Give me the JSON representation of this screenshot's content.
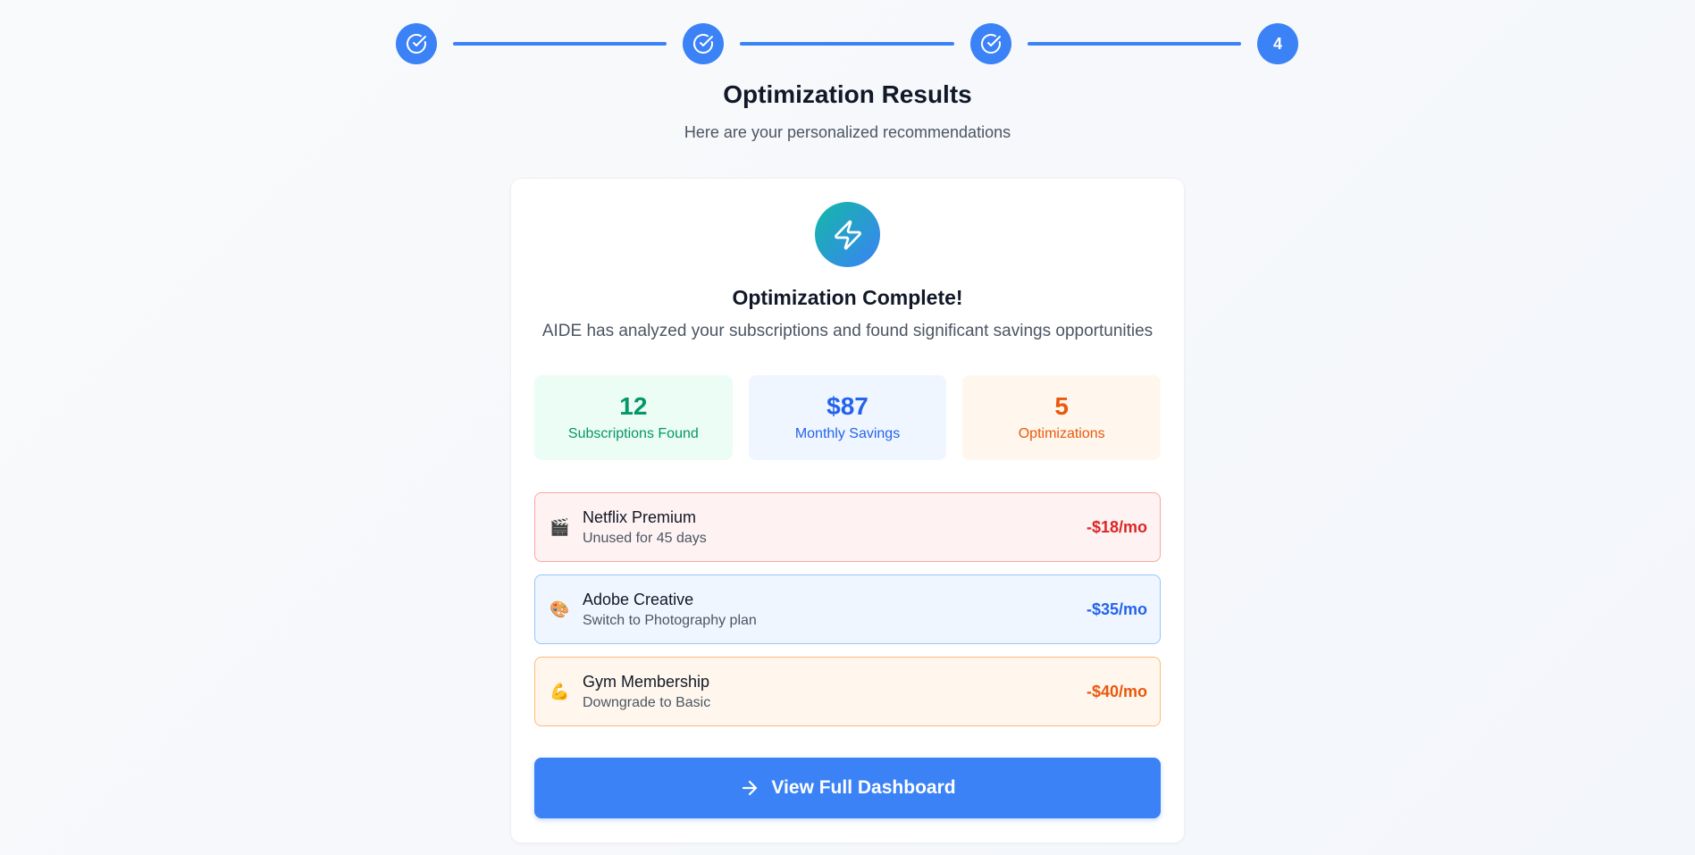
{
  "stepper": {
    "steps": [
      {
        "state": "complete",
        "icon": "check-circle-icon"
      },
      {
        "state": "complete",
        "icon": "check-circle-icon"
      },
      {
        "state": "complete",
        "icon": "check-circle-icon"
      },
      {
        "state": "current",
        "label": "4"
      }
    ]
  },
  "header": {
    "title": "Optimization Results",
    "subtitle": "Here are your personalized recommendations"
  },
  "card": {
    "icon": "lightning-bolt-icon",
    "title": "Optimization Complete!",
    "description": "AIDE has analyzed your subscriptions and found significant savings opportunities",
    "stats": [
      {
        "value": "12",
        "label": "Subscriptions Found",
        "color": "#059669"
      },
      {
        "value": "$87",
        "label": "Monthly Savings",
        "color": "#2563eb"
      },
      {
        "value": "5",
        "label": "Optimizations",
        "color": "#ea580c"
      }
    ],
    "optimizations": [
      {
        "emoji": "🎬",
        "name": "Netflix Premium",
        "detail": "Unused for 45 days",
        "saving": "-$18/mo",
        "color": "#dc2626"
      },
      {
        "emoji": "🎨",
        "name": "Adobe Creative",
        "detail": "Switch to Photography plan",
        "saving": "-$35/mo",
        "color": "#2563eb"
      },
      {
        "emoji": "💪",
        "name": "Gym Membership",
        "detail": "Downgrade to Basic",
        "saving": "-$40/mo",
        "color": "#ea580c"
      }
    ],
    "cta_label": "View Full Dashboard",
    "cta_icon": "arrow-right-icon"
  },
  "colors": {
    "accent": "#3b82f6"
  }
}
